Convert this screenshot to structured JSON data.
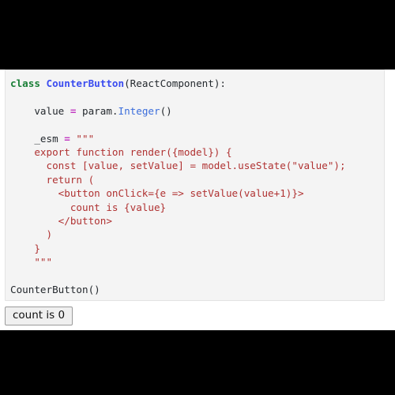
{
  "window": {
    "background_color": "#000000",
    "stage_color": "#ffffff"
  },
  "code_cell": {
    "background_color": "#f4f4f4",
    "border_color": "#e3e3e3",
    "language": "python",
    "colors": {
      "keyword": "#1a7f37",
      "class_name": "#3b4cf0",
      "type_name": "#3b6ddb",
      "operator": "#c23ac2",
      "string": "#b03232",
      "plain": "#24292e"
    },
    "lines": {
      "l1_kw": "class",
      "l1_sp": " ",
      "l1_cls": "CounterButton",
      "l1_rest": "(ReactComponent):",
      "l2_blank": "",
      "l3_indent": "    value ",
      "l3_op": "=",
      "l3_mid": " param.",
      "l3_type": "Integer",
      "l3_end": "()",
      "l4_blank": "",
      "l5_indent": "    _esm ",
      "l5_op": "=",
      "l5_str": " \"\"\"",
      "l6": "    export function render({model}) {",
      "l7": "      const [value, setValue] = model.useState(\"value\");",
      "l8": "      return (",
      "l9": "        <button onClick={e => setValue(value+1)}>",
      "l10": "          count is {value}",
      "l11": "        </button>",
      "l12": "      )",
      "l13": "    }",
      "l14": "    \"\"\"",
      "l15_blank": "",
      "l16": "CounterButton()"
    }
  },
  "widget": {
    "count_button_label": "count is 0",
    "count_button_bg": "#f0f0f0",
    "count_button_border": "#9a9a9a"
  }
}
